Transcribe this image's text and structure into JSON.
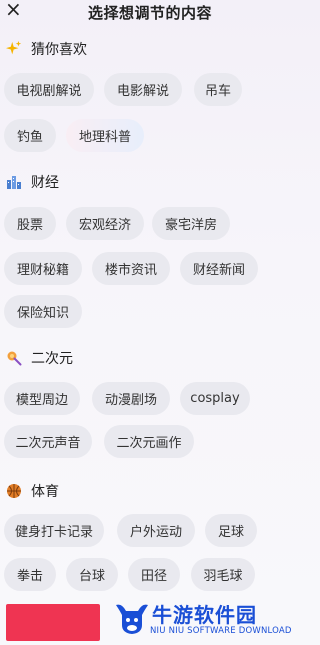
{
  "header": {
    "title": "选择想调节的内容",
    "close_icon": "×"
  },
  "sections": [
    {
      "title": "猜你喜欢",
      "icon": "sparkles-icon",
      "items": [
        "电视剧解说",
        "电影解说",
        "吊车",
        "钓鱼",
        "地理科普"
      ],
      "selected": "地理科普"
    },
    {
      "title": "财经",
      "icon": "finance-building-icon",
      "items": [
        "股票",
        "宏观经济",
        "豪宅洋房",
        "理财秘籍",
        "楼市资讯",
        "财经新闻",
        "保险知识"
      ]
    },
    {
      "title": "二次元",
      "icon": "magic-wand-icon",
      "items": [
        "模型周边",
        "动漫剧场",
        "cosplay",
        "二次元声音",
        "二次元画作"
      ]
    },
    {
      "title": "体育",
      "icon": "basketball-icon",
      "items": [
        "健身打卡记录",
        "户外运动",
        "足球",
        "拳击",
        "台球",
        "田径",
        "羽毛球"
      ]
    }
  ],
  "watermark": {
    "title": "牛游软件园",
    "subtitle": "NIU NIU SOFTWARE DOWNLOAD"
  },
  "colors": {
    "accent_red": "#ef3452",
    "chip_bg": "#e9e9ef",
    "watermark_blue": "#1a4fd6"
  }
}
